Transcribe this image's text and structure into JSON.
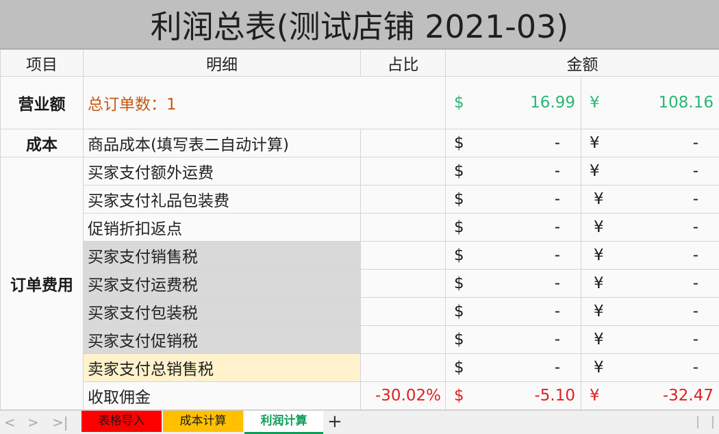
{
  "title": "利润总表(测试店铺 2021-03)",
  "headers": {
    "item": "项目",
    "detail": "明细",
    "ratio": "占比",
    "amount": "金额"
  },
  "revenue": {
    "category": "营业额",
    "orders_label": "总订单数：",
    "orders_count": "1",
    "usd_symbol": "$",
    "usd_value": "16.99",
    "cny_symbol": "¥",
    "cny_value": "108.16"
  },
  "cost": {
    "category": "成本",
    "detail": "商品成本(填写表二自动计算)",
    "usd_symbol": "$",
    "usd_value": "-",
    "cny_symbol": "¥",
    "cny_value": "-"
  },
  "order_fees": {
    "category": "订单费用",
    "rows": [
      {
        "detail": "买家支付额外运费",
        "ratio": "",
        "usd_symbol": "$",
        "usd_value": "-",
        "cny_symbol": "¥",
        "cny_value": "-"
      },
      {
        "detail": "买家支付礼品包装费",
        "ratio": "",
        "usd_symbol": "$",
        "usd_value": "-",
        "cny_symbol": "¥",
        "cny_value": "-"
      },
      {
        "detail": "促销折扣返点",
        "ratio": "",
        "usd_symbol": "$",
        "usd_value": "-",
        "cny_symbol": "¥",
        "cny_value": "-"
      },
      {
        "detail": "买家支付销售税",
        "ratio": "",
        "usd_symbol": "$",
        "usd_value": "-",
        "cny_symbol": "¥",
        "cny_value": "-"
      },
      {
        "detail": "买家支付运费税",
        "ratio": "",
        "usd_symbol": "$",
        "usd_value": "-",
        "cny_symbol": "¥",
        "cny_value": "-"
      },
      {
        "detail": "买家支付包装税",
        "ratio": "",
        "usd_symbol": "$",
        "usd_value": "-",
        "cny_symbol": "¥",
        "cny_value": "-"
      },
      {
        "detail": "买家支付促销税",
        "ratio": "",
        "usd_symbol": "$",
        "usd_value": "-",
        "cny_symbol": "¥",
        "cny_value": "-"
      },
      {
        "detail": "卖家支付总销售税",
        "ratio": "",
        "usd_symbol": "$",
        "usd_value": "-",
        "cny_symbol": "¥",
        "cny_value": "-"
      },
      {
        "detail": "收取佣金",
        "ratio": "-30.02%",
        "usd_symbol": "$",
        "usd_value": "-5.10",
        "cny_symbol": "¥",
        "cny_value": "-32.47"
      }
    ]
  },
  "tabs": [
    {
      "label": "表格导入",
      "color": "#ff0000"
    },
    {
      "label": "成本计算",
      "color": "#ffc000"
    },
    {
      "label": "利润计算",
      "color": "#0f9d58",
      "active": true
    }
  ],
  "nav": {
    "prev": "<",
    "next": ">",
    "last": ">|",
    "add": "+"
  },
  "colors": {
    "green": "#2bb673",
    "red": "#e02020",
    "orange_text": "#c65911",
    "gray_fill": "#d9d9d9",
    "yellow_fill": "#fff2cc"
  }
}
